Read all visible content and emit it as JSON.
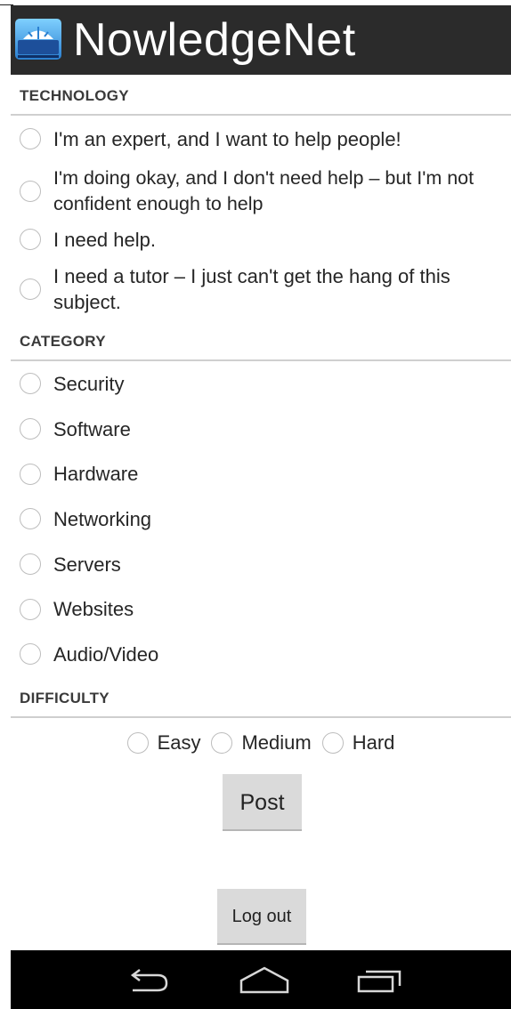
{
  "app": {
    "title": "NowledgeNet",
    "icon": "app-logo-icon"
  },
  "technology": {
    "header": "TECHNOLOGY",
    "options": [
      {
        "label": "I'm an expert, and I want to help people!",
        "selected": false
      },
      {
        "label": "I'm doing okay, and I don't need help – but I'm not confident enough to help",
        "selected": false
      },
      {
        "label": "I need help.",
        "selected": false
      },
      {
        "label": "I need a tutor – I just can't get the hang of this subject.",
        "selected": false
      }
    ]
  },
  "category": {
    "header": "CATEGORY",
    "options": [
      {
        "label": "Security",
        "selected": false
      },
      {
        "label": "Software",
        "selected": false
      },
      {
        "label": "Hardware",
        "selected": false
      },
      {
        "label": "Networking",
        "selected": false
      },
      {
        "label": "Servers",
        "selected": false
      },
      {
        "label": "Websites",
        "selected": false
      },
      {
        "label": "Audio/Video",
        "selected": false
      }
    ]
  },
  "difficulty": {
    "header": "DIFFICULTY",
    "options": [
      {
        "label": "Easy",
        "selected": false
      },
      {
        "label": "Medium",
        "selected": false
      },
      {
        "label": "Hard",
        "selected": false
      }
    ]
  },
  "actions": {
    "post_label": "Post",
    "logout_label": "Log out"
  },
  "navigation": {
    "back_icon": "back-icon",
    "home_icon": "home-icon",
    "recent_icon": "recent-apps-icon"
  },
  "colors": {
    "action_bar": "#2b2b2b",
    "nav_bar": "#000000",
    "button": "#dadada",
    "divider": "#cfcfcf"
  }
}
